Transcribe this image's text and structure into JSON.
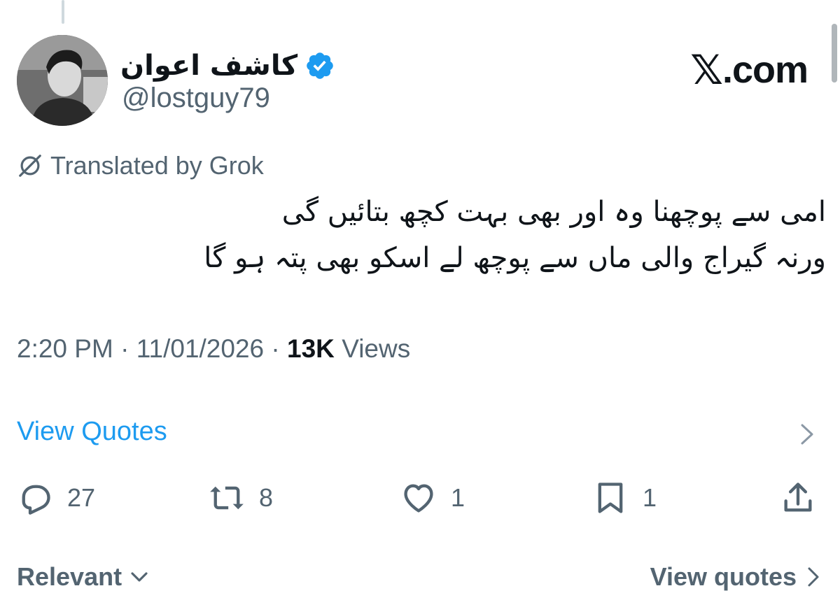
{
  "author": {
    "display_name": "کاشف اعوان",
    "handle": "@lostguy79",
    "verified": true
  },
  "brand": {
    "domain_suffix": ".com"
  },
  "translation": {
    "label": "Translated by Grok"
  },
  "tweet": {
    "lines": [
      "امی سے پوچھنا وہ  اور بھی بہت کچھ بتائیں گی",
      "ورنہ گیراج  والی ماں  سے پوچھ   لے   اسکو بھی پتہ ہو گا"
    ],
    "time": "2:20 PM",
    "separator": "·",
    "date": "11/01/2026",
    "views_count": "13K",
    "views_label": "Views"
  },
  "quotes": {
    "label": "View Quotes"
  },
  "actions": {
    "replies": "27",
    "reposts": "8",
    "likes": "1",
    "bookmarks": "1"
  },
  "footer": {
    "sort_label": "Relevant",
    "view_quotes_label": "View quotes"
  },
  "colors": {
    "accent": "#1d9bf0",
    "secondary_text": "#536471",
    "primary_text": "#0f1419"
  },
  "icons": [
    "verified-icon",
    "grok-icon",
    "chevron-right-icon",
    "reply-icon",
    "repost-icon",
    "like-icon",
    "bookmark-icon",
    "share-icon",
    "chevron-down-icon"
  ]
}
